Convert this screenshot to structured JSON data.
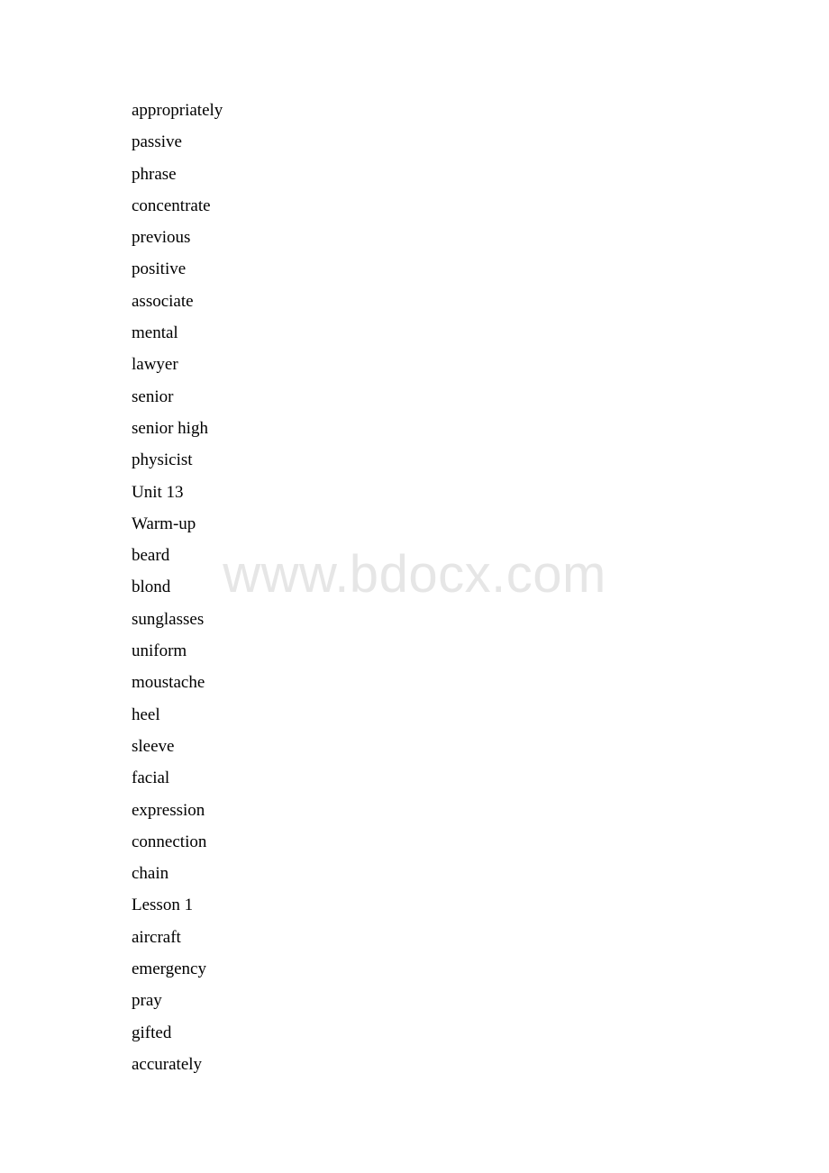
{
  "document": {
    "type": "word-list",
    "background_color": "#ffffff",
    "text_color": "#000000"
  },
  "watermark": {
    "text": "www.bdocx.com",
    "color": "#e6e6e6"
  },
  "word_list": {
    "items": [
      {
        "text": "appropriately"
      },
      {
        "text": "passive"
      },
      {
        "text": "phrase"
      },
      {
        "text": "concentrate"
      },
      {
        "text": "previous"
      },
      {
        "text": "positive"
      },
      {
        "text": "associate"
      },
      {
        "text": "mental"
      },
      {
        "text": "lawyer"
      },
      {
        "text": "senior"
      },
      {
        "text": "senior high"
      },
      {
        "text": "physicist"
      },
      {
        "text": "Unit 13"
      },
      {
        "text": "Warm-up"
      },
      {
        "text": "beard"
      },
      {
        "text": "blond"
      },
      {
        "text": "sunglasses"
      },
      {
        "text": "uniform"
      },
      {
        "text": "moustache"
      },
      {
        "text": "heel"
      },
      {
        "text": "sleeve"
      },
      {
        "text": "facial"
      },
      {
        "text": "expression"
      },
      {
        "text": "connection"
      },
      {
        "text": "chain"
      },
      {
        "text": "Lesson 1"
      },
      {
        "text": "aircraft"
      },
      {
        "text": "emergency"
      },
      {
        "text": "pray"
      },
      {
        "text": "gifted"
      },
      {
        "text": "accurately"
      }
    ]
  }
}
